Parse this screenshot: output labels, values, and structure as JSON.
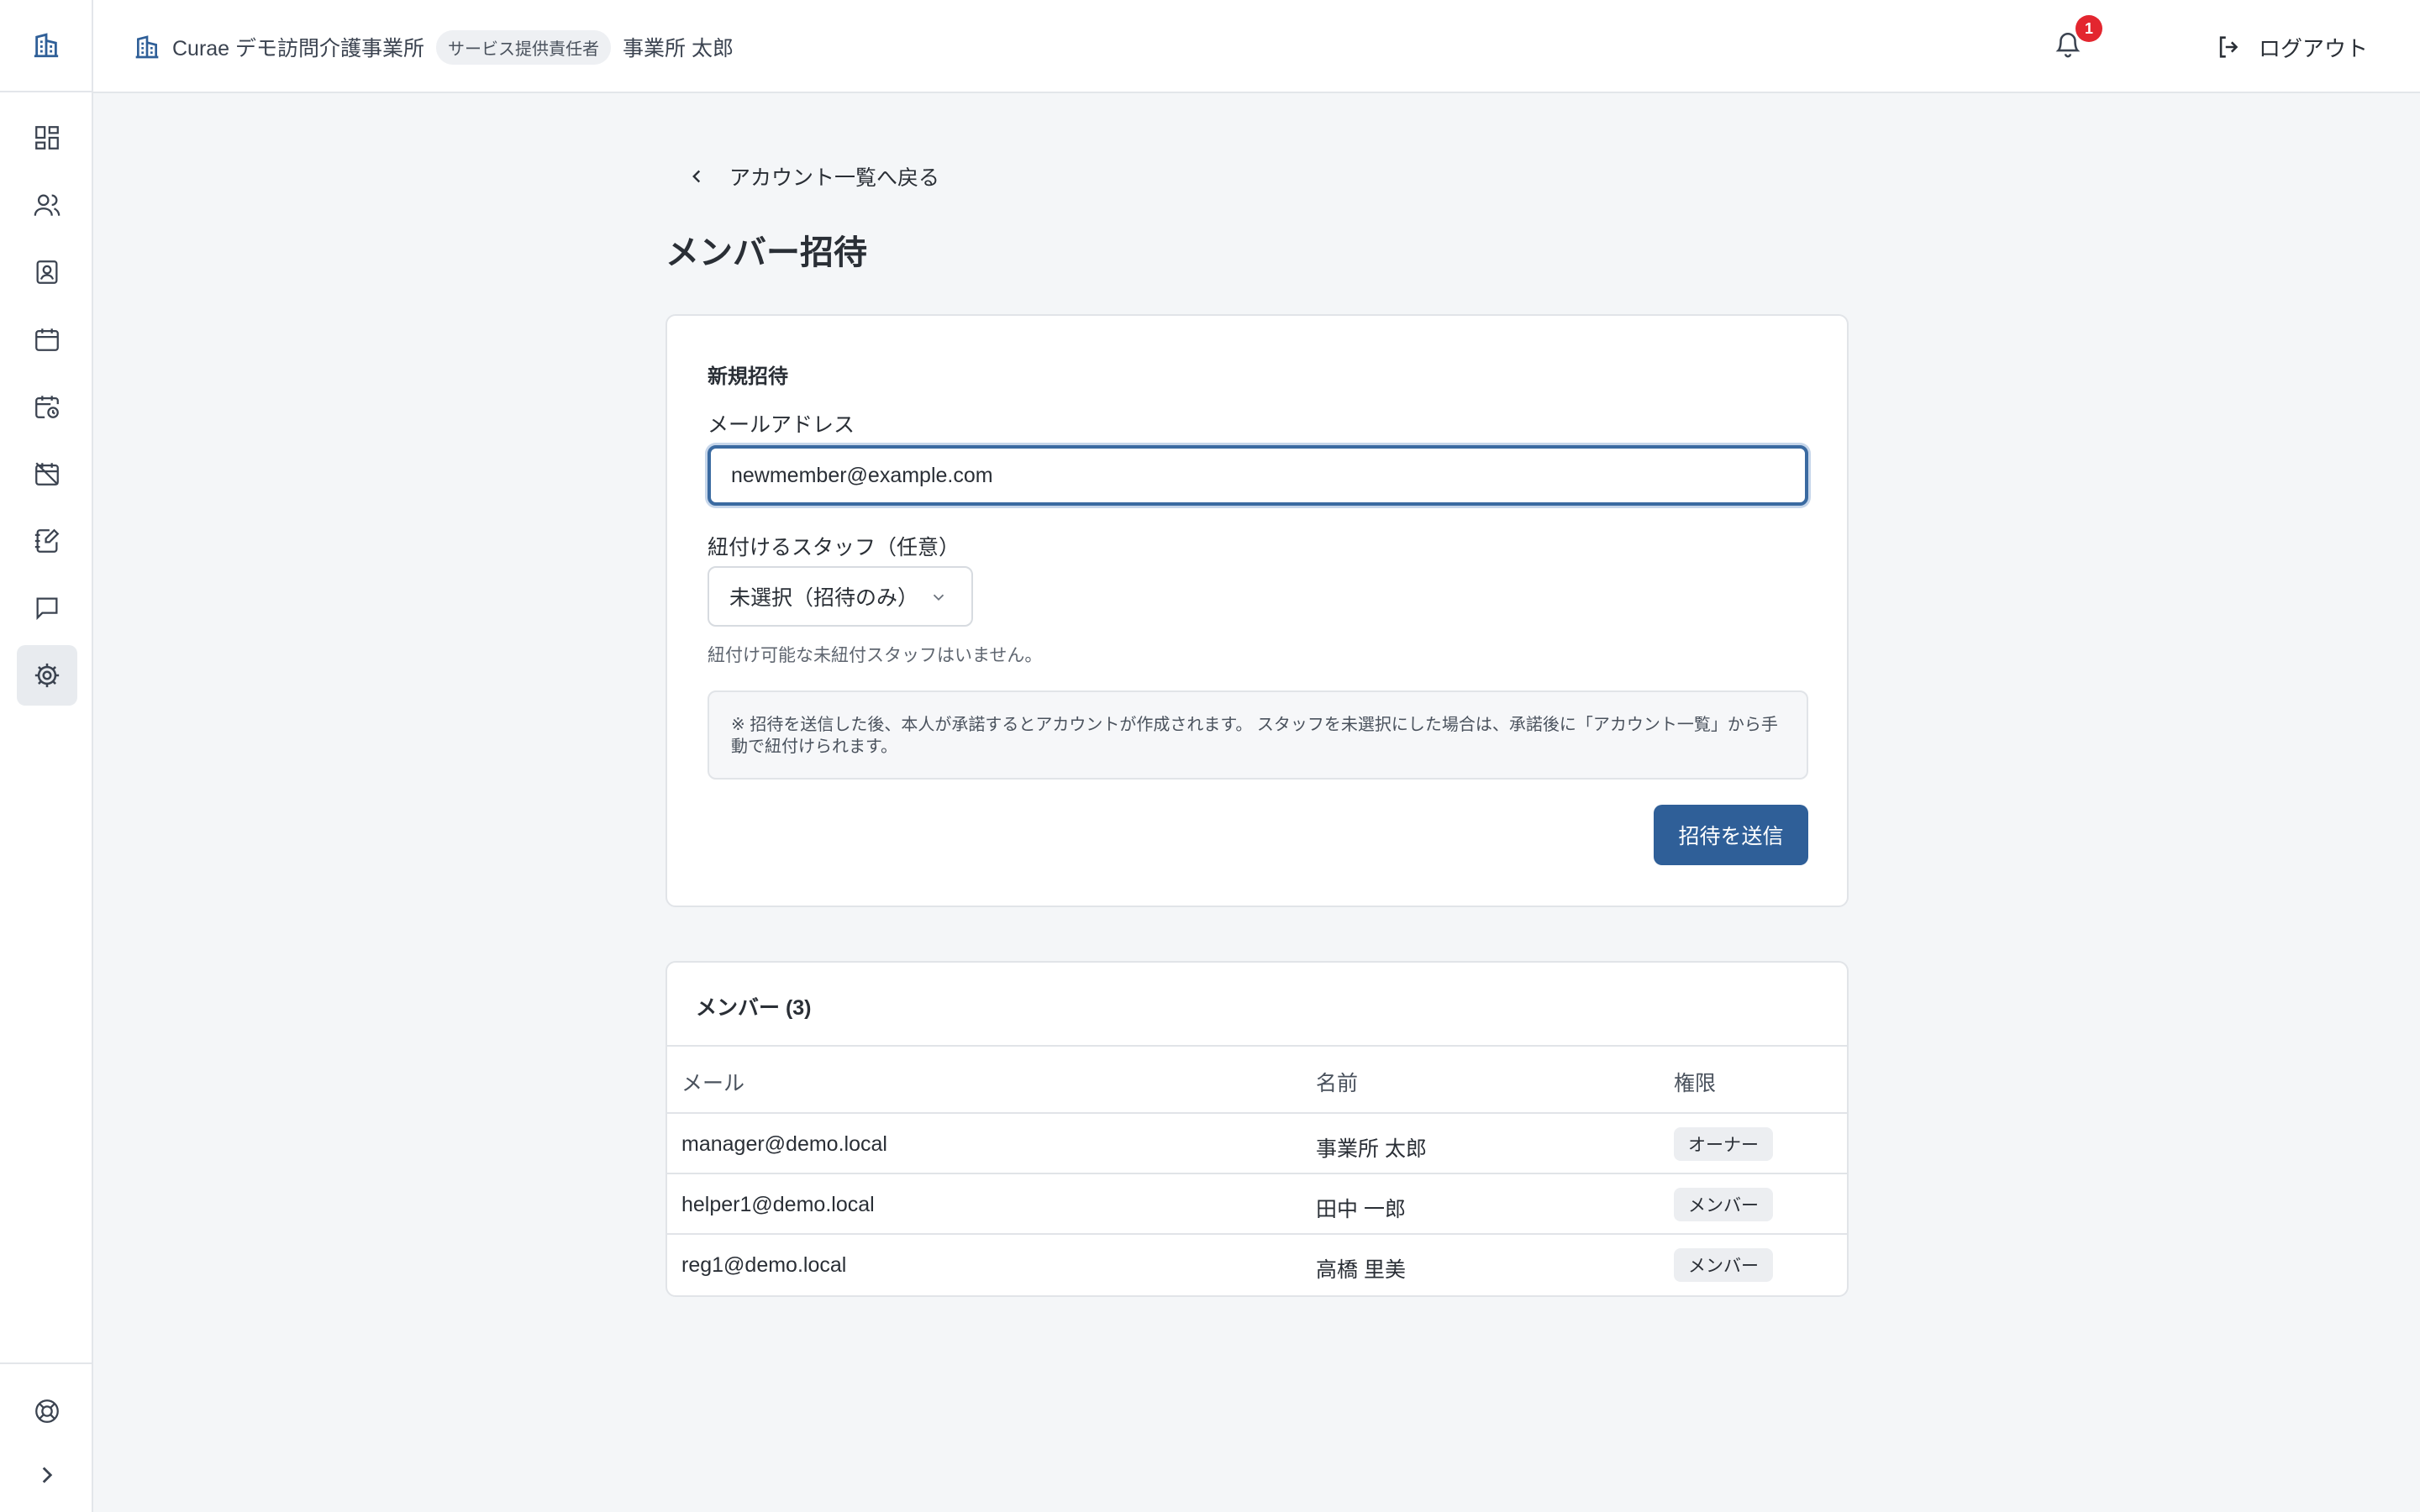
{
  "header": {
    "org_name": "Curae デモ訪問介護事業所",
    "role": "サービス提供責任者",
    "user_name": "事業所 太郎",
    "notification_count": "1",
    "logout_label": "ログアウト"
  },
  "sidebar": {
    "items": [
      {
        "icon": "dashboard-icon"
      },
      {
        "icon": "users-icon"
      },
      {
        "icon": "contact-icon"
      },
      {
        "icon": "calendar-icon"
      },
      {
        "icon": "calendar-clock-icon"
      },
      {
        "icon": "calendar-off-icon"
      },
      {
        "icon": "notebook-edit-icon"
      },
      {
        "icon": "message-icon"
      },
      {
        "icon": "gear-icon",
        "active": true
      }
    ],
    "bottom": [
      {
        "icon": "help-buoy-icon"
      },
      {
        "icon": "chevron-right-icon"
      }
    ]
  },
  "main": {
    "back_label": "アカウント一覧へ戻る",
    "title": "メンバー招待",
    "invite": {
      "section_title": "新規招待",
      "email_label": "メールアドレス",
      "email_value": "newmember@example.com",
      "staff_label": "紐付けるスタッフ（任意）",
      "staff_selected": "未選択（招待のみ）",
      "staff_hint": "紐付け可能な未紐付スタッフはいません。",
      "notice_line1": "※ 招待を送信した後、本人が承諾するとアカウントが作成されます。 スタッフを未選択にした場合は、承諾後に「アカウント一覧」から手",
      "notice_line2": "動で紐付けられます。",
      "submit_label": "招待を送信"
    },
    "members": {
      "title": "メンバー (3)",
      "columns": [
        "メール",
        "名前",
        "権限"
      ],
      "rows": [
        {
          "email": "manager@demo.local",
          "name": "事業所 太郎",
          "role": "オーナー"
        },
        {
          "email": "helper1@demo.local",
          "name": "田中 一郎",
          "role": "メンバー"
        },
        {
          "email": "reg1@demo.local",
          "name": "高橋 里美",
          "role": "メンバー"
        }
      ]
    }
  },
  "colors": {
    "primary": "#2f5f98",
    "badge_red": "#e3262f",
    "logo_blue": "#2f5f98"
  }
}
